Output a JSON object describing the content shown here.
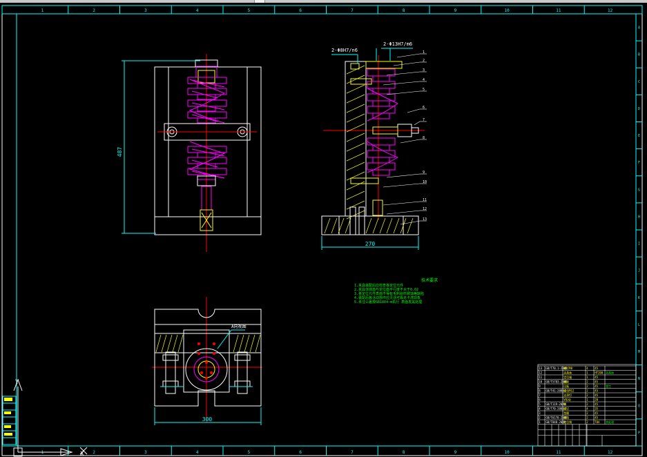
{
  "app": {
    "toolbar_state": "collapsed"
  },
  "colors": {
    "background": "#000000",
    "frame": "#ffffff",
    "border": "#00ffff",
    "part": "#ff00ff",
    "centerline": "#ff0000",
    "dimension": "#00ffff",
    "notes": "#00ff00",
    "highlight": "#ffff00"
  },
  "drawing": {
    "columns": [
      "1",
      "2",
      "3",
      "4",
      "5",
      "6",
      "7",
      "8",
      "9",
      "10",
      "11",
      "12"
    ],
    "rows": [
      "A",
      "B",
      "C",
      "D",
      "E",
      "F",
      "G",
      "H",
      "I",
      "J",
      "K",
      "L",
      "M",
      "N",
      "O",
      "P"
    ],
    "dims": {
      "height": "487",
      "width_side": "270",
      "width_plan": "300"
    },
    "fit_labels": {
      "fit1": "2-Φ8H7/n6",
      "fit2": "2-Φ13H7/m6"
    },
    "balloons": [
      "1",
      "2",
      "3",
      "4",
      "5",
      "6",
      "7",
      "8",
      "9",
      "10",
      "11",
      "12",
      "13"
    ],
    "section_label": "A向视图",
    "notes": {
      "title": "技术要求",
      "lines": [
        "1.夹具装配后应检查各定位元件",
        "2.夹具体底面与定位面平行度不大于0.02",
        "3.各定位元件表面不得有毛刺划伤锈蚀等缺陷",
        "4.装配后各活动部件应灵活可靠无卡滞现象",
        "5.未注公差按GB1804-m执行 表面发黑处理"
      ]
    },
    "title_block": {
      "rows": [
        [
          "13",
          "GB/T70.1-2000",
          "螺钉M8",
          "4",
          "45",
          ""
        ],
        [
          "12",
          "",
          "夹具体",
          "1",
          "HT200",
          "夹具体"
        ],
        [
          "11",
          "",
          "定位轴",
          "1",
          "45",
          ""
        ],
        [
          "10",
          "GB/T5783-2000",
          "螺栓",
          "2",
          "45",
          ""
        ],
        [
          "9",
          "",
          "压板",
          "2",
          "45",
          "钳工"
        ],
        [
          "8",
          "GB/T41-2000",
          "螺母M12",
          "2",
          "45",
          ""
        ],
        [
          "7",
          "",
          "支承钉",
          "2",
          "45",
          ""
        ],
        [
          "6",
          "",
          "V形块",
          "1",
          "20",
          ""
        ],
        [
          "5",
          "GB/T119-2000",
          "销",
          "2",
          "45",
          ""
        ],
        [
          "4",
          "GB/T70-2000",
          "螺钉",
          "4",
          "35",
          ""
        ],
        [
          "3",
          "",
          "垫圈",
          "2",
          "45",
          ""
        ],
        [
          "2",
          "GB/T6170-2000",
          "螺母",
          "2",
          "45",
          ""
        ],
        [
          "1",
          "GB/T848-2000",
          "定位销",
          "2",
          "T8A",
          "热处理"
        ]
      ]
    },
    "ucs": {
      "x_label": "X",
      "y_label": "Y"
    }
  }
}
